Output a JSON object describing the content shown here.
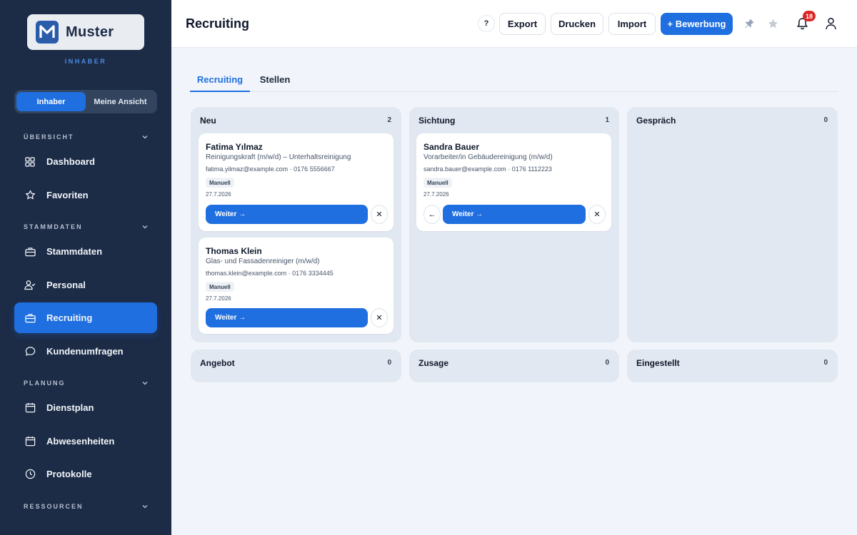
{
  "app": {
    "logo_text": "Muster",
    "role_label": "INHABER",
    "view_toggle": {
      "active": "Inhaber",
      "other": "Meine Ansicht"
    }
  },
  "sidebar": {
    "sections": {
      "overview": "ÜBERSICHT",
      "master": "STAMMDATEN",
      "planning": "PLANUNG",
      "resources": "RESSOURCEN"
    },
    "items": [
      {
        "label": "Dashboard",
        "icon": "grid-icon"
      },
      {
        "label": "Favoriten",
        "icon": "star-icon"
      },
      {
        "label": "Stammdaten",
        "icon": "briefcase-icon"
      },
      {
        "label": "Personal",
        "icon": "people-icon"
      },
      {
        "label": "Recruiting",
        "icon": "briefcase-icon",
        "active": true
      },
      {
        "label": "Kundenumfragen",
        "icon": "chat-icon"
      },
      {
        "label": "Dienstplan",
        "icon": "calendar-icon"
      },
      {
        "label": "Abwesenheiten",
        "icon": "calendar-icon"
      },
      {
        "label": "Protokolle",
        "icon": "clock-icon"
      }
    ]
  },
  "header": {
    "title": "Recruiting",
    "help": "?",
    "export": "Export",
    "print": "Drucken",
    "import": "Import",
    "new_application": "+ Bewerbung",
    "notification_count": "18"
  },
  "tabs": [
    {
      "label": "Recruiting",
      "active": true
    },
    {
      "label": "Stellen",
      "active": false
    }
  ],
  "board": {
    "columns": [
      {
        "title": "Neu",
        "count": "2"
      },
      {
        "title": "Sichtung",
        "count": "1"
      },
      {
        "title": "Gespräch",
        "count": "0"
      },
      {
        "title": "Angebot",
        "count": "0"
      },
      {
        "title": "Zusage",
        "count": "0"
      },
      {
        "title": "Eingestellt",
        "count": "0"
      }
    ],
    "cards": [
      {
        "name": "Fatima Yılmaz",
        "role": "Reinigungskraft (m/w/d) – Unterhaltsreinigung",
        "contact": "fatima.yilmaz@example.com · 0176 5556667",
        "source": "Manuell",
        "date": "27.7.2026",
        "next": "Weiter →",
        "close": "✕"
      },
      {
        "name": "Thomas Klein",
        "role": "Glas- und Fassadenreiniger (m/w/d)",
        "contact": "thomas.klein@example.com · 0176 3334445",
        "source": "Manuell",
        "date": "27.7.2026",
        "next": "Weiter →",
        "close": "✕"
      },
      {
        "name": "Sandra Bauer",
        "role": "Vorarbeiter/in Gebäudereinigung (m/w/d)",
        "contact": "sandra.bauer@example.com · 0176 1112223",
        "source": "Manuell",
        "date": "27.7.2026",
        "back": "←",
        "next": "Weiter →",
        "close": "✕"
      }
    ]
  },
  "colors": {
    "sidebar_bg": "#1c2b46",
    "accent": "#1f6fe0",
    "badge_red": "#dc2626",
    "page_bg": "#f1f5fb",
    "column_bg": "#e2e8f1"
  }
}
